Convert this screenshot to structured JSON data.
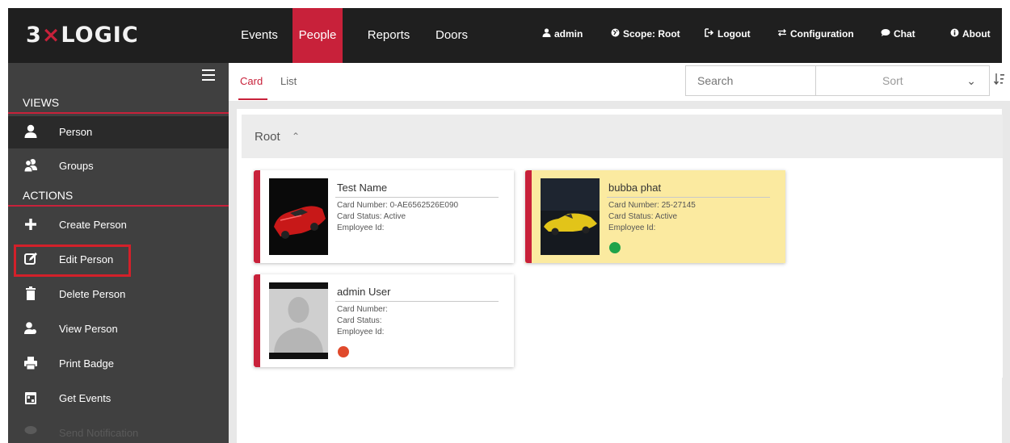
{
  "logo": {
    "prefix": "3",
    "x": "×",
    "suffix": "LOGIC"
  },
  "nav": {
    "events": "Events",
    "people": "People",
    "reports": "Reports",
    "doors": "Doors"
  },
  "util": {
    "admin": "admin",
    "scope": "Scope: Root",
    "logout": "Logout",
    "configuration": "Configuration",
    "chat": "Chat",
    "about": "About"
  },
  "sidebar": {
    "views_heading": "VIEWS",
    "actions_heading": "ACTIONS",
    "views": [
      {
        "label": "Person"
      },
      {
        "label": "Groups"
      }
    ],
    "actions": [
      {
        "label": "Create Person"
      },
      {
        "label": "Edit Person"
      },
      {
        "label": "Delete Person"
      },
      {
        "label": "View Person"
      },
      {
        "label": "Print Badge"
      },
      {
        "label": "Get Events"
      },
      {
        "label": "Send Notification"
      }
    ]
  },
  "tabs": {
    "card": "Card",
    "list": "List"
  },
  "search": {
    "placeholder": "Search"
  },
  "sort": {
    "label": "Sort"
  },
  "group": {
    "title": "Root"
  },
  "people": [
    {
      "name": "Test Name",
      "card_number": "Card Number: 0-AE6562526E090",
      "card_status": "Card Status: Active",
      "employee_id": "Employee Id:"
    },
    {
      "name": "bubba phat",
      "card_number": "Card Number: 25-27145",
      "card_status": "Card Status: Active",
      "employee_id": "Employee Id:",
      "status_color": "#1fa34a"
    },
    {
      "name": "admin User",
      "card_number": "Card Number:",
      "card_status": "Card Status:",
      "employee_id": "Employee Id:",
      "status_color": "#e04a2c"
    }
  ],
  "colors": {
    "accent": "#c8213a",
    "topbar": "#1f1f1f",
    "sidebar": "#404040",
    "selected_card": "#fbeaa0"
  }
}
